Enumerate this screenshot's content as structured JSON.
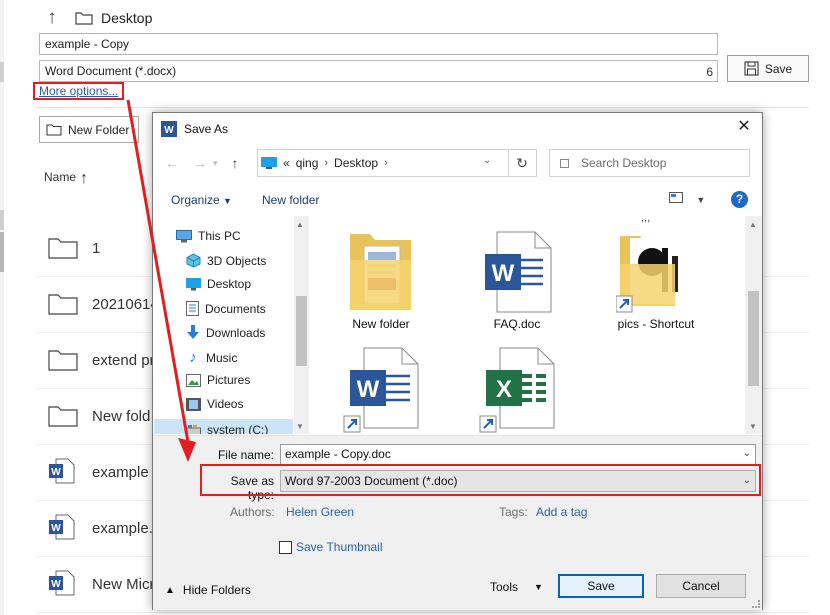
{
  "background": {
    "path": "Desktop",
    "file_name": "example - Copy",
    "file_type": "Word Document (*.docx)",
    "type_count": "6",
    "save_label": "Save",
    "more_options": "More options...",
    "new_folder": "New Folder",
    "name_header": "Name",
    "rows": [
      {
        "label": "1",
        "icon": "folder-icon"
      },
      {
        "label": "20210614",
        "icon": "folder-icon"
      },
      {
        "label": "extend pr",
        "icon": "folder-icon"
      },
      {
        "label": "New fold",
        "icon": "folder-icon"
      },
      {
        "label": "example",
        "icon": "word-doc-icon"
      },
      {
        "label": "example.",
        "icon": "word-doc-icon"
      },
      {
        "label": "New Micr",
        "icon": "word-doc-icon"
      }
    ]
  },
  "dialog": {
    "title": "Save As",
    "address": {
      "sep": "«",
      "crumbs": [
        "qing",
        "Desktop"
      ]
    },
    "search_placeholder": "Search Desktop",
    "toolbar": {
      "organize": "Organize",
      "new_folder": "New folder"
    },
    "nav": [
      {
        "label": "This PC",
        "icon": "pc-icon"
      },
      {
        "label": "3D Objects",
        "icon": "cube-icon"
      },
      {
        "label": "Desktop",
        "icon": "desktop-icon"
      },
      {
        "label": "Documents",
        "icon": "documents-icon"
      },
      {
        "label": "Downloads",
        "icon": "download-icon"
      },
      {
        "label": "Music",
        "icon": "music-icon"
      },
      {
        "label": "Pictures",
        "icon": "pictures-icon"
      },
      {
        "label": "Videos",
        "icon": "videos-icon"
      },
      {
        "label": "system (C:)",
        "icon": "drive-icon"
      }
    ],
    "files": [
      {
        "label": "New folder",
        "icon": "folder-icon"
      },
      {
        "label": "FAQ.doc",
        "icon": "word-doc-icon"
      },
      {
        "label": "pics - Shortcut",
        "icon": "folder-shortcut-icon"
      },
      {
        "label": "",
        "icon": "word-shortcut-icon"
      },
      {
        "label": "",
        "icon": "excel-shortcut-icon"
      }
    ],
    "file_name_label": "File name:",
    "file_name_value": "example - Copy.doc",
    "save_type_label": "Save as type:",
    "save_type_value": "Word 97-2003 Document (*.doc)",
    "authors_label": "Authors:",
    "authors_value": "Helen Green",
    "tags_label": "Tags:",
    "tags_value": "Add a tag",
    "save_thumbnail": "Save Thumbnail",
    "hide_folders": "Hide Folders",
    "tools": "Tools",
    "save": "Save",
    "cancel": "Cancel"
  },
  "colors": {
    "highlight": "#e02020",
    "link": "#2763b0",
    "word_blue": "#2b579a",
    "excel_green": "#217346"
  }
}
